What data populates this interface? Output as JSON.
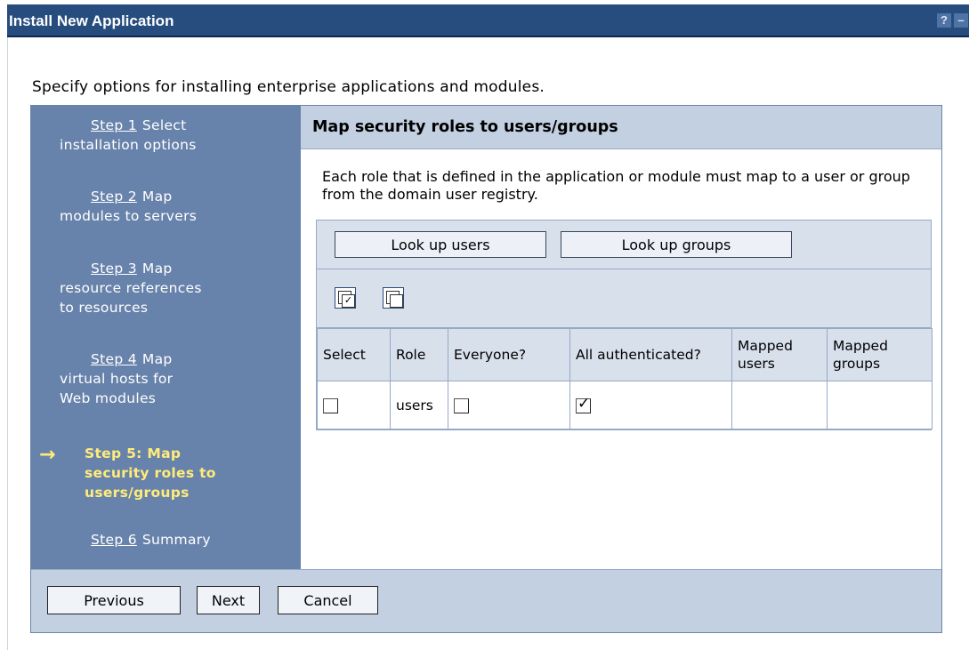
{
  "window": {
    "title": "Install New Application",
    "help_label": "?",
    "minimize_label": "–"
  },
  "intro_text": "Specify options for installing enterprise applications and modules.",
  "steps": [
    {
      "num": "Step 1",
      "label": "Select installation options",
      "line2": ""
    },
    {
      "num": "Step 2",
      "label": "Map modules to servers"
    },
    {
      "num": "Step 3",
      "label": "Map resource references to resources"
    },
    {
      "num": "Step 4",
      "label": "Map virtual hosts for Web modules"
    },
    {
      "num": "Step 5:",
      "label": "Map security roles to users/groups",
      "current": true
    },
    {
      "num": "Step 6",
      "label": "Summary"
    }
  ],
  "current_step_arrow": "→",
  "panel": {
    "heading": "Map security roles to users/groups",
    "description": "Each role that is defined in the application or module must map to a user or group from the domain user registry."
  },
  "buttons": {
    "lookup_users": "Look up users",
    "lookup_groups": "Look up groups",
    "previous": "Previous",
    "next": "Next",
    "cancel": "Cancel"
  },
  "table": {
    "headers": [
      "Select",
      "Role",
      "Everyone?",
      "All authenticated?",
      "Mapped users",
      "Mapped groups"
    ],
    "rows": [
      {
        "select": false,
        "role": "users",
        "everyone": false,
        "all_authenticated": true,
        "mapped_users": "",
        "mapped_groups": ""
      }
    ]
  },
  "colors": {
    "titlebar": "#274c7e",
    "steps_panel": "#6883ab",
    "current_step": "#ffec7a",
    "header_band": "#c2d0e2"
  }
}
